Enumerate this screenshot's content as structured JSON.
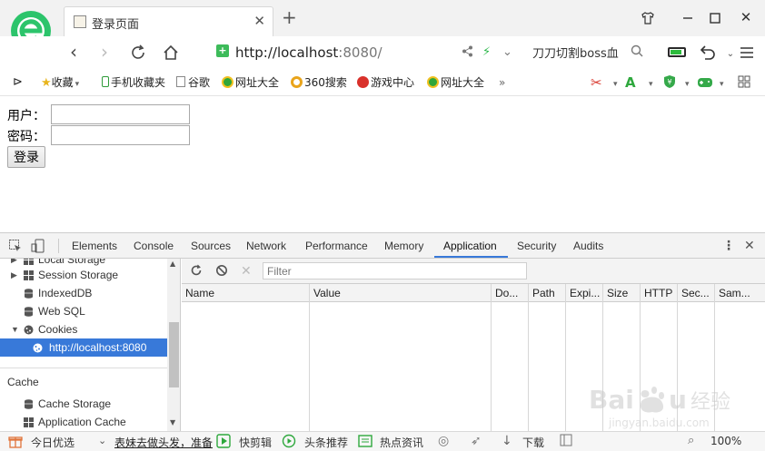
{
  "browser": {
    "tab_title": "登录页面",
    "address_url_host": "http://localhost",
    "address_url_port": ":8080/",
    "search_text": "刀刀切割boss血"
  },
  "bookmarks": [
    {
      "label": "收藏",
      "icon": "star-icon",
      "color": "#e8b51e",
      "has_arrow": true
    },
    {
      "label": "手机收藏夹",
      "icon": "phone-icon",
      "color": "#2f9b3a"
    },
    {
      "label": "谷歌",
      "icon": "document-icon",
      "color": "#888888"
    },
    {
      "label": "网址大全",
      "icon": "urls-icon",
      "color": "#2fa63a"
    },
    {
      "label": "360搜索",
      "icon": "search360-icon",
      "color": "#e9a41b"
    },
    {
      "label": "游戏中心",
      "icon": "game-center-icon",
      "color": "#d9312b"
    },
    {
      "label": "网址大全",
      "icon": "urls-icon",
      "color": "#2fa63a"
    }
  ],
  "page": {
    "username_label": "用户：",
    "password_label": "密码：",
    "username_value": "",
    "password_value": "",
    "login_button": "登录"
  },
  "devtools": {
    "tabs": [
      "Elements",
      "Console",
      "Sources",
      "Network",
      "Performance",
      "Memory",
      "Application",
      "Security",
      "Audits"
    ],
    "active_tab": "Application",
    "sidebar": {
      "items_top": [
        {
          "label": "Local Storage",
          "icon": "storage-grid-icon"
        },
        {
          "label": "Session Storage",
          "icon": "storage-grid-icon"
        },
        {
          "label": "IndexedDB",
          "icon": "database-icon"
        },
        {
          "label": "Web SQL",
          "icon": "database-icon"
        },
        {
          "label": "Cookies",
          "icon": "cookie-icon"
        }
      ],
      "selected_child": "http://localhost:8080",
      "cache_header": "Cache",
      "cache_items": [
        {
          "label": "Cache Storage",
          "icon": "database-icon"
        },
        {
          "label": "Application Cache",
          "icon": "storage-grid-icon"
        }
      ]
    },
    "filter_placeholder": "Filter",
    "columns": [
      "Name",
      "Value",
      "Do...",
      "Path",
      "Expi...",
      "Size",
      "HTTP",
      "Sec...",
      "Sam..."
    ]
  },
  "status": {
    "today_pick": "今日优选",
    "news": "表妹去做头发，准备",
    "quick_edit": "快剪辑",
    "headlines": "头条推荐",
    "hot_news": "热点资讯",
    "download": "下载",
    "zoom": "100%"
  },
  "colors": {
    "accent_blue": "#3879d9",
    "logo_green": "#2cc46b"
  }
}
